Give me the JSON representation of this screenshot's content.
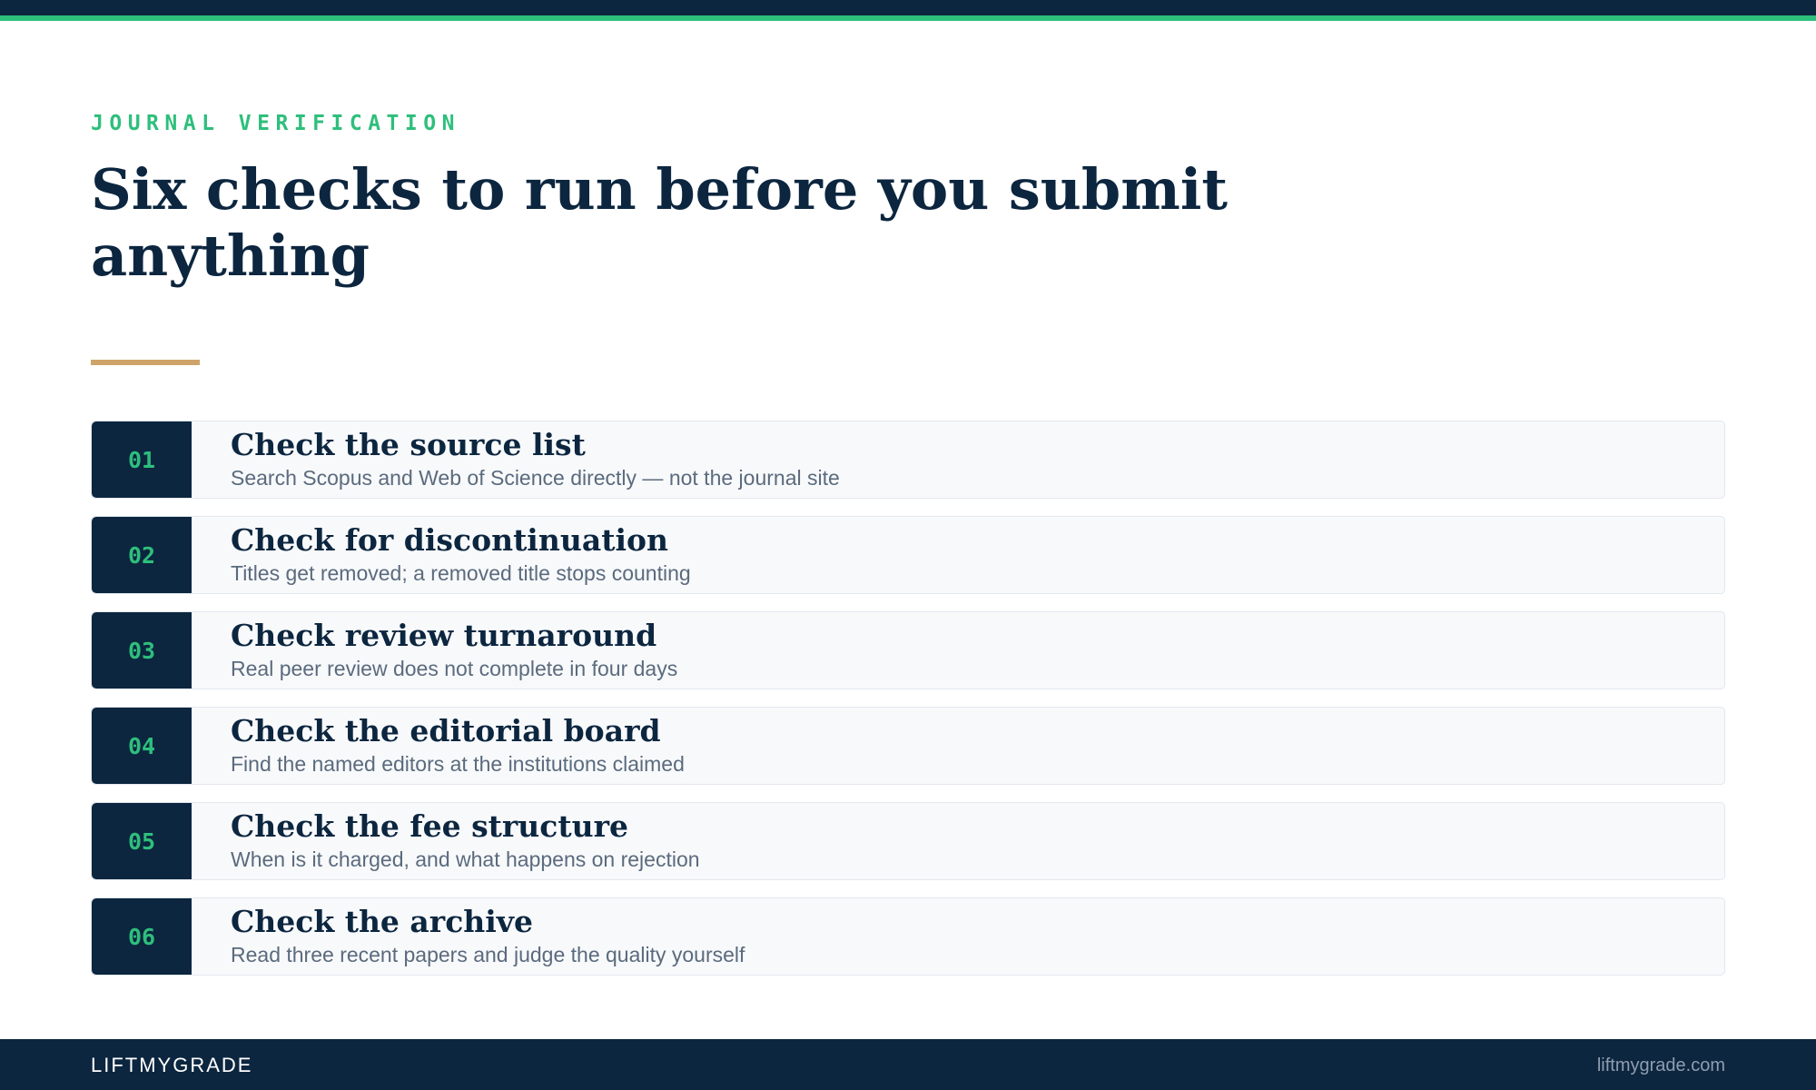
{
  "header": {
    "eyebrow": "JOURNAL VERIFICATION",
    "title": "Six checks to run before you submit anything"
  },
  "checks": [
    {
      "number": "01",
      "title": "Check the source list",
      "description": "Search Scopus and Web of Science directly — not the journal site"
    },
    {
      "number": "02",
      "title": "Check for discontinuation",
      "description": "Titles get removed; a removed title stops counting"
    },
    {
      "number": "03",
      "title": "Check review turnaround",
      "description": "Real peer review does not complete in four days"
    },
    {
      "number": "04",
      "title": "Check the editorial board",
      "description": "Find the named editors at the institutions claimed"
    },
    {
      "number": "05",
      "title": "Check the fee structure",
      "description": "When is it charged, and what happens on rejection"
    },
    {
      "number": "06",
      "title": "Check the archive",
      "description": "Read three recent papers and judge the quality yourself"
    }
  ],
  "footer": {
    "brand": "LIFTMYGRADE",
    "site": "liftmygrade.com"
  },
  "colors": {
    "navy": "#0d2640",
    "green": "#2fbf7c",
    "gold": "#cfa46a"
  }
}
